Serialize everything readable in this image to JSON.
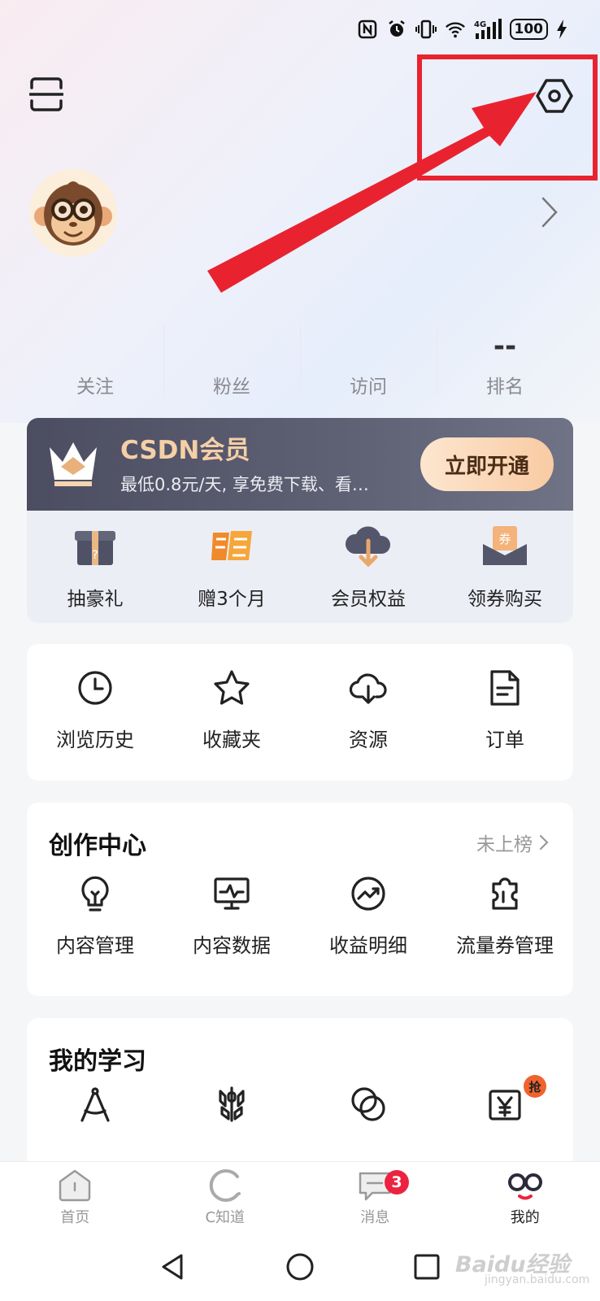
{
  "status_bar": {
    "network": "4G",
    "battery": "100",
    "icons": [
      "nfc-icon",
      "alarm-icon",
      "vibrate-icon",
      "wifi-icon",
      "signal-icon",
      "battery-icon",
      "charging-icon"
    ]
  },
  "header": {
    "scan_icon": "scan-icon",
    "settings_icon": "settings-hexagon-icon"
  },
  "profile": {
    "avatar": "monkey-avatar",
    "stats": [
      {
        "label": "关注",
        "value": ""
      },
      {
        "label": "粉丝",
        "value": ""
      },
      {
        "label": "访问",
        "value": ""
      },
      {
        "label": "排名",
        "value": "--"
      }
    ]
  },
  "vip": {
    "title": "CSDN会员",
    "subtitle": "最低0.8元/天, 享免费下载、看…",
    "button": "立即开通",
    "items": [
      {
        "label": "抽豪礼",
        "icon": "mystery-box-icon"
      },
      {
        "label": "赠3个月",
        "icon": "gift-zeng-icon"
      },
      {
        "label": "会员权益",
        "icon": "cloud-download-icon"
      },
      {
        "label": "领券购买",
        "icon": "coupon-icon"
      }
    ],
    "colors": {
      "title": "#f5cfa6",
      "button_text": "#4a2c17"
    }
  },
  "tools": [
    {
      "label": "浏览历史",
      "icon": "clock-icon"
    },
    {
      "label": "收藏夹",
      "icon": "star-icon"
    },
    {
      "label": "资源",
      "icon": "cloud-download-icon"
    },
    {
      "label": "订单",
      "icon": "document-icon"
    }
  ],
  "create_center": {
    "title": "创作中心",
    "link": "未上榜",
    "items": [
      {
        "label": "内容管理",
        "icon": "lightbulb-icon"
      },
      {
        "label": "内容数据",
        "icon": "monitor-chart-icon"
      },
      {
        "label": "收益明细",
        "icon": "trend-up-icon"
      },
      {
        "label": "流量券管理",
        "icon": "ticket-icon"
      }
    ]
  },
  "learning": {
    "title": "我的学习",
    "badge": "抢",
    "icons": [
      "compass-icon",
      "wheat-icon",
      "circles-icon",
      "yen-icon"
    ]
  },
  "tabbar": {
    "tabs": [
      {
        "label": "首页",
        "icon": "home-icon"
      },
      {
        "label": "C知道",
        "icon": "c-icon"
      },
      {
        "label": "消息",
        "icon": "message-icon",
        "badge": "3"
      },
      {
        "label": "我的",
        "icon": "profile-glasses-icon"
      }
    ]
  },
  "watermark": {
    "text": "Baidu经验",
    "sub": "jingyan.baidu.com"
  },
  "colors": {
    "annotation_red": "#e8232f",
    "badge_red": "#ec2340"
  }
}
